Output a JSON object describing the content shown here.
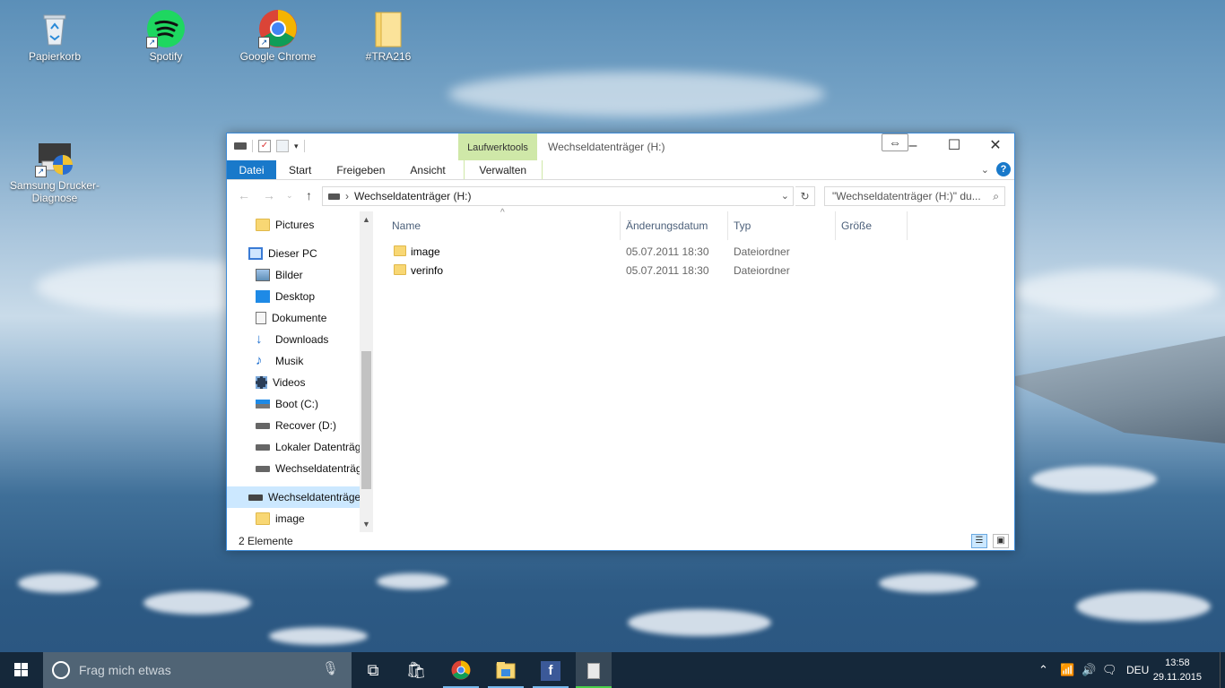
{
  "desktop": {
    "icons": [
      {
        "label": "Papierkorb",
        "icon": "recycle-bin-icon"
      },
      {
        "label": "Spotify",
        "icon": "spotify-icon"
      },
      {
        "label": "Google Chrome",
        "icon": "chrome-icon"
      },
      {
        "label": "#TRA216",
        "icon": "folder-icon"
      },
      {
        "label": "Samsung Drucker-Diagnose",
        "icon": "printer-icon"
      }
    ]
  },
  "window": {
    "title": "Wechseldatenträger (H:)",
    "context_group": "Laufwerktools",
    "tabs": [
      "Datei",
      "Start",
      "Freigeben",
      "Ansicht",
      "Verwalten"
    ],
    "address": "Wechseldatenträger (H:)",
    "search_placeholder": "\"Wechseldatenträger (H:)\" du...",
    "nav": [
      {
        "label": "Pictures",
        "icon": "folder-icon"
      },
      {
        "label": "Dieser PC",
        "icon": "computer-icon"
      },
      {
        "label": "Bilder",
        "icon": "pictures-icon"
      },
      {
        "label": "Desktop",
        "icon": "desktop-icon"
      },
      {
        "label": "Dokumente",
        "icon": "documents-icon"
      },
      {
        "label": "Downloads",
        "icon": "download-icon"
      },
      {
        "label": "Musik",
        "icon": "music-icon"
      },
      {
        "label": "Videos",
        "icon": "videos-icon"
      },
      {
        "label": "Boot (C:)",
        "icon": "windows-drive-icon"
      },
      {
        "label": "Recover (D:)",
        "icon": "drive-icon"
      },
      {
        "label": "Lokaler Datenträg",
        "icon": "drive-icon"
      },
      {
        "label": "Wechseldatenträg",
        "icon": "drive-icon"
      },
      {
        "label": "Wechseldatenträger",
        "icon": "drive-icon"
      },
      {
        "label": "image",
        "icon": "folder-icon"
      }
    ],
    "columns": [
      "Name",
      "Änderungsdatum",
      "Typ",
      "Größe"
    ],
    "files": [
      {
        "name": "image",
        "date": "05.07.2011 18:30",
        "type": "Dateiordner"
      },
      {
        "name": "verinfo",
        "date": "05.07.2011 18:30",
        "type": "Dateiordner"
      }
    ],
    "status": "2 Elemente"
  },
  "taskbar": {
    "search_placeholder": "Frag mich etwas",
    "language": "DEU",
    "time": "13:58",
    "date": "29.11.2015"
  },
  "colors": {
    "accent": "#1979ca",
    "context_tab": "#cfe8a8",
    "selection": "#cce8ff"
  }
}
